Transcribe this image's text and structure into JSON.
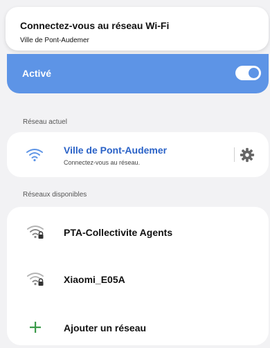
{
  "notification": {
    "title": "Connectez-vous au réseau Wi-Fi",
    "subtitle": "Ville de Pont-Audemer"
  },
  "wifi_toggle": {
    "label": "Activé",
    "enabled": true,
    "accent_color": "#5d94e6"
  },
  "current_network": {
    "section_title": "Réseau actuel",
    "ssid": "Ville de Pont-Audemer",
    "status": "Connectez-vous au réseau.",
    "icon": "wifi-icon",
    "settings_icon": "gear-icon",
    "ssid_color": "#2a62c7"
  },
  "available_networks": {
    "section_title": "Réseaux disponibles",
    "items": [
      {
        "ssid": "PTA-Collectivite Agents",
        "icon": "wifi-lock-icon"
      },
      {
        "ssid": "Xiaomi_E05A",
        "icon": "wifi-lock-icon"
      }
    ],
    "add_label": "Ajouter un réseau",
    "add_icon": "plus-icon",
    "add_color": "#3a9a4a"
  }
}
